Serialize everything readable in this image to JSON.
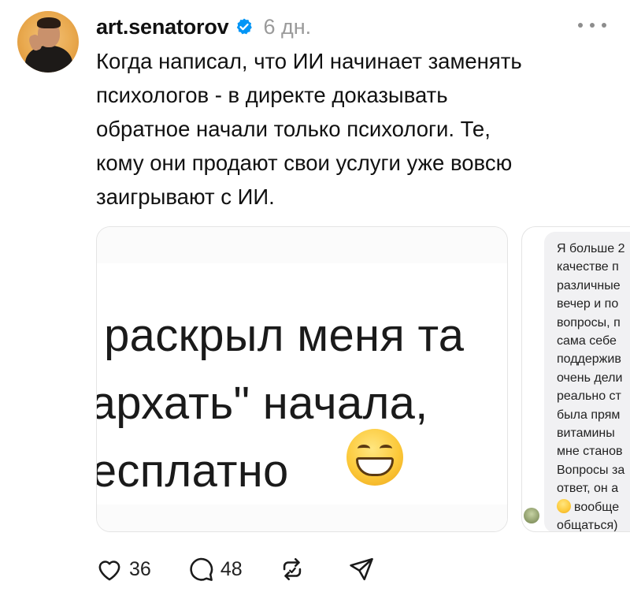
{
  "post": {
    "username": "art.senatorov",
    "time": "6 дн.",
    "text": "Когда написал, что ИИ начинает заменять\nпсихологов - в директе доказывать\nобратное начали только психологи. Те,\nкому они продают свои услуги уже вовсю\nзаигрывают с ИИ."
  },
  "media": {
    "image1_text": "и раскрыл меня та\nпархать\" начала,\nбесплатно",
    "image2_lines": [
      "Я больше 2",
      "качестве п",
      "различные",
      "вечер и по",
      "вопросы, п",
      "сама себе",
      "поддержив",
      "очень дели",
      "реально ст",
      "была прям",
      "витамины",
      "мне станов",
      "Вопросы за",
      "ответ, он а",
      "вообще",
      "общаться)"
    ]
  },
  "actions": {
    "likes": "36",
    "comments": "48"
  },
  "icons": {
    "verified": "verified-badge-icon",
    "more": "more-options-icon",
    "like": "heart-icon",
    "comment": "comment-bubble-icon",
    "repost": "repost-icon",
    "share": "send-icon",
    "emoji": "grinning-face-emoji"
  },
  "colors": {
    "verified": "#0095f6",
    "muted": "#9a9a9a",
    "text": "#111111"
  }
}
